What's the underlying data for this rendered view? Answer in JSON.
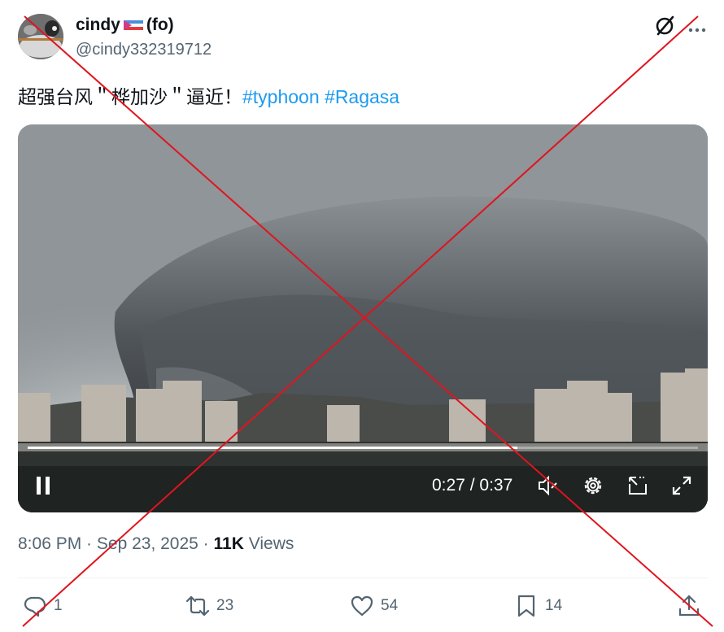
{
  "author": {
    "display_name": "cindy",
    "display_name_suffix": "(fo)",
    "handle": "@cindy332319712",
    "flag_icon": "flag-emoji-icon"
  },
  "tweet": {
    "text": "超强台风＂桦加沙＂逼近！",
    "hashtags": [
      "#typhoon",
      "#Ragasa"
    ]
  },
  "video": {
    "current_time": "0:27",
    "separator": " / ",
    "duration": "0:37",
    "progress_fraction": 0.73,
    "icons": [
      "pause-icon",
      "mute-icon",
      "settings-icon",
      "pop-out-icon",
      "fullscreen-icon"
    ]
  },
  "meta": {
    "time": "8:06 PM",
    "dot": " · ",
    "date": "Sep 23, 2025",
    "views_count": "11K",
    "views_label": " Views"
  },
  "actions": {
    "replies": "1",
    "reposts": "23",
    "likes": "54",
    "bookmarks": "14"
  },
  "colors": {
    "accent": "#1d9bf0",
    "cross": "#e0141e",
    "secondary_text": "#536471"
  }
}
